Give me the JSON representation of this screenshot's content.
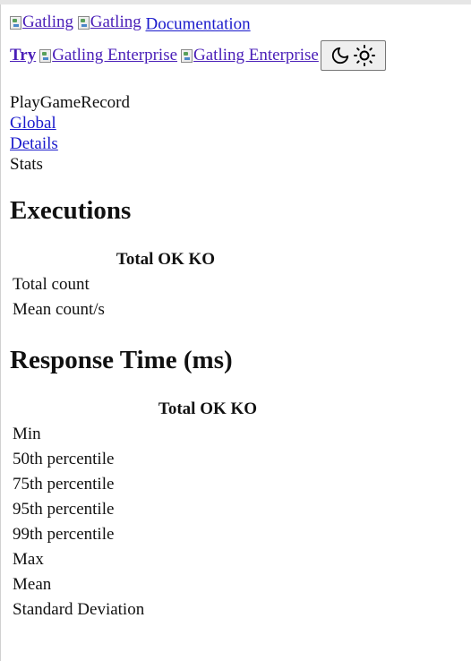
{
  "nav": {
    "logo_alt_1": "Gatling",
    "logo_alt_2": "Gatling",
    "documentation_link": "Documentation",
    "try_label": "Try",
    "enterprise_alt_1": "Gatling Enterprise",
    "enterprise_alt_2": "Gatling Enterprise",
    "theme_toggle": {
      "icons": [
        "moon-icon",
        "sun-icon"
      ]
    }
  },
  "menu": {
    "simulation": "PlayGameRecord",
    "items": [
      "Global",
      "Details",
      "Stats"
    ]
  },
  "executions": {
    "heading": "Executions",
    "columns": [
      "",
      "Total OK KO"
    ],
    "rows": [
      "Total count",
      "Mean count/s"
    ]
  },
  "response_time": {
    "heading": "Response Time (ms)",
    "columns": [
      "",
      "Total OK KO"
    ],
    "rows": [
      "Min",
      "50th percentile",
      "75th percentile",
      "95th percentile",
      "99th percentile",
      "Max",
      "Mean",
      "Standard Deviation"
    ]
  },
  "colors": {
    "visited_link": "#4a1fb8",
    "link": "#1a1acc"
  }
}
